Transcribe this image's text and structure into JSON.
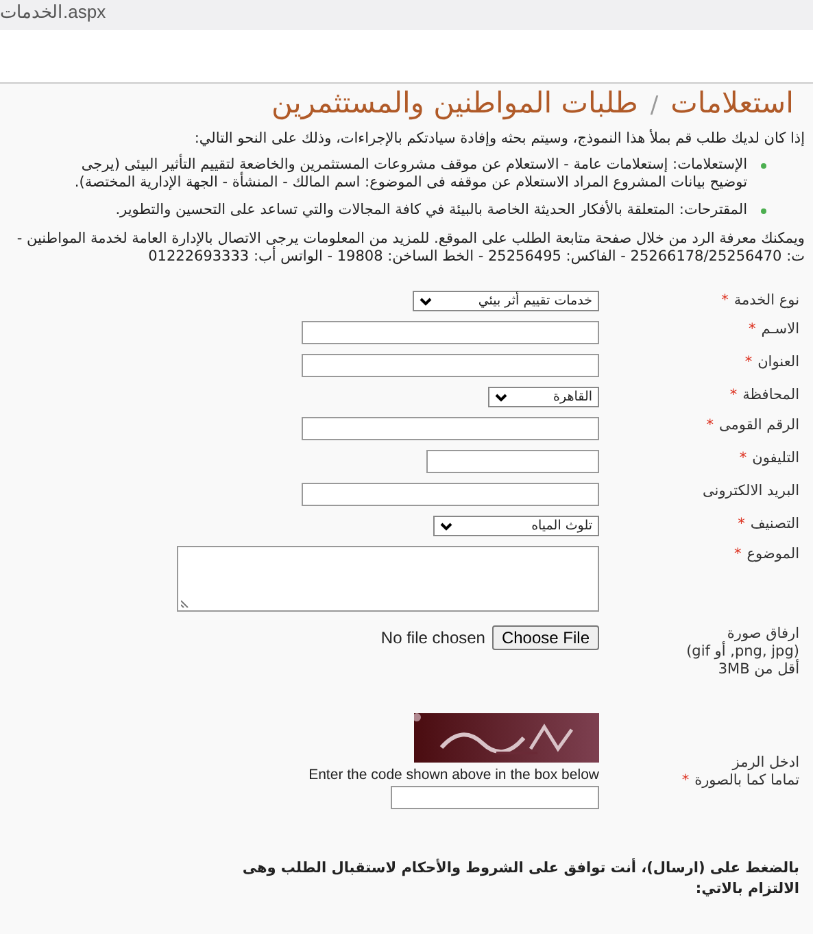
{
  "tab": {
    "title": "الخدمات.aspx"
  },
  "page_title": {
    "main": "استعلامات",
    "separator": "/",
    "sub": "طلبات المواطنين والمستثمرين"
  },
  "intro": "إذا كان لديك طلب قم بملأ هذا النموذج، وسيتم بحثه وإفادة سيادتكم بالإجراءات، وذلك على النحو التالي:",
  "bullets": [
    {
      "text": "الإستعلامات: إستعلامات عامة - الاستعلام عن موقف مشروعات المستثمرين والخاضعة لتقييم التأثير البيئى (يرجى توضيح بيانات المشروع المراد الاستعلام عن موقفه فى الموضوع: اسم المالك - المنشأة - الجهة الإدارية المختصة)."
    },
    {
      "text": "المقترحات: المتعلقة بالأفكار الحديثة الخاصة بالبيئة في كافة المجالات والتي تساعد على التحسين والتطوير."
    }
  ],
  "contact": "ويمكنك معرفة الرد من خلال صفحة متابعة الطلب على الموقع. للمزيد من المعلومات يرجى الاتصال بالإدارة العامة لخدمة المواطنين - ت: 25266178/25256470 - الفاكس: 25256495 - الخط الساخن: 19808 - الواتس أب: 01222693333",
  "fields": [
    {
      "kind": "select",
      "label": [
        "نوع الخدمة"
      ],
      "asterisk": "*",
      "value": "خدمات تقييم أثر بيئي"
    },
    {
      "kind": "input",
      "label": [
        "الاسـم"
      ],
      "asterisk": "*"
    },
    {
      "kind": "input",
      "label": [
        "العنوان"
      ],
      "asterisk": "*"
    },
    {
      "kind": "select",
      "label": [
        "المحافظة"
      ],
      "asterisk": "*",
      "value": "القاهرة"
    },
    {
      "kind": "input",
      "label": [
        "الرقم القومى"
      ],
      "asterisk": "*"
    },
    {
      "kind": "input",
      "label": [
        "التليفون"
      ],
      "asterisk": "*"
    },
    {
      "kind": "input",
      "label": [
        "البريد الالكترونى"
      ]
    },
    {
      "kind": "select",
      "label": [
        "التصنيف"
      ],
      "asterisk": "*",
      "value": "تلوث المياه"
    },
    {
      "kind": "textarea",
      "label": [
        "الموضوع"
      ],
      "asterisk": "*"
    },
    {
      "kind": "file",
      "label": [
        "ارفاق صورة",
        "(png, jpg, أو gif)",
        "أقل من 3MB"
      ],
      "button": "Choose File",
      "status": "No file chosen"
    },
    {
      "kind": "captcha",
      "label": [
        "ادخل الرمز",
        "تماما كما بالصورة"
      ],
      "asterisk": "*",
      "hint": "Enter the code shown above in the box below"
    }
  ],
  "terms": "بالضغط على (ارسال)، أنت توافق على الشروط والأحكام لاستقبال الطلب وهى الالتزام بالاتي:"
}
